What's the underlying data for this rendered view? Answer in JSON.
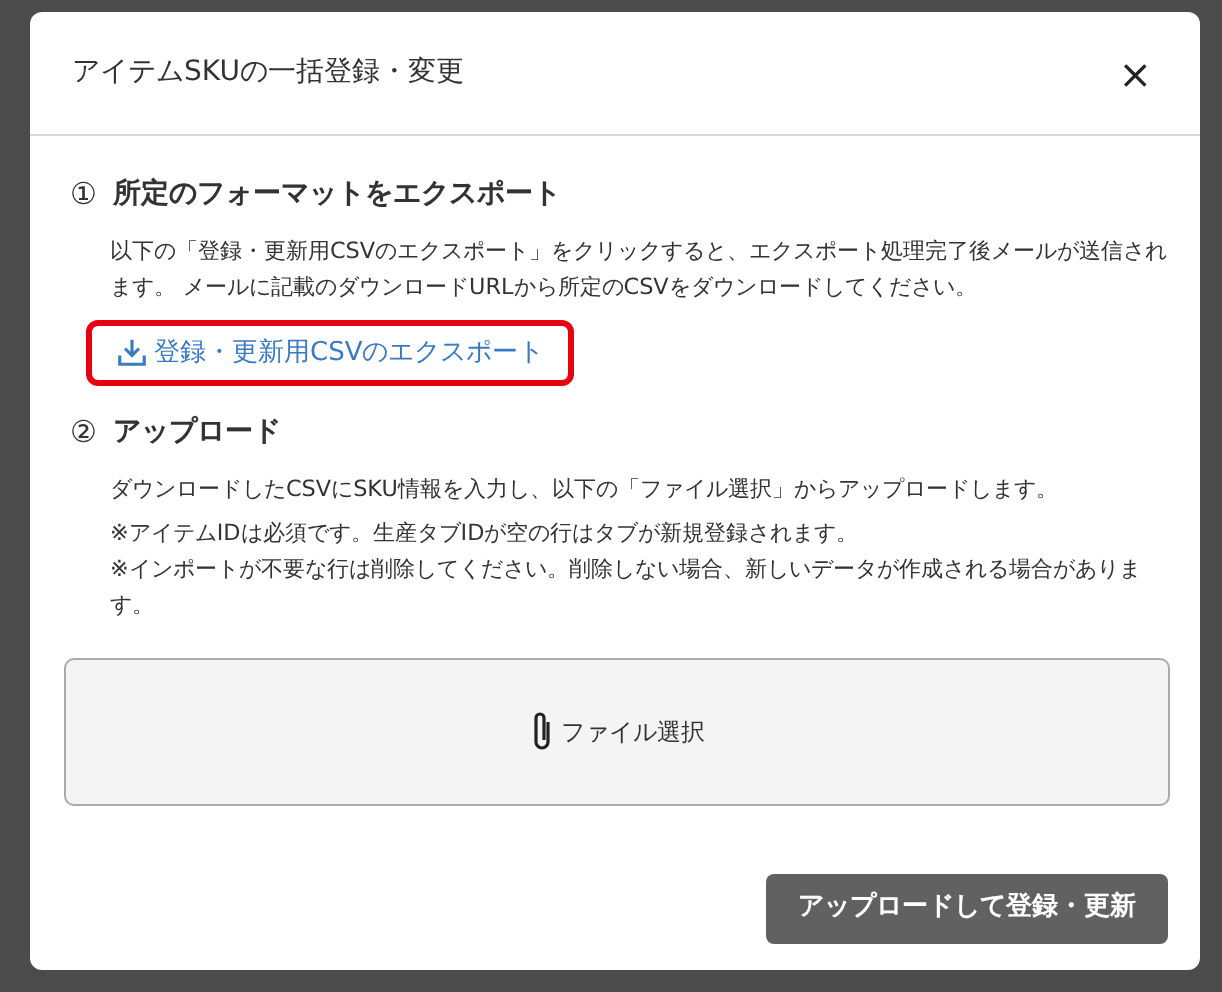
{
  "modal": {
    "title": "アイテムSKUの一括登録・変更",
    "close": "×",
    "sections": [
      {
        "number": "①",
        "heading": "所定のフォーマットをエクスポート",
        "paragraphs": [
          "以下の「登録・更新用CSVのエクスポート」をクリックすると、エクスポート処理完了後メールが送信されます。 メールに記載のダウンロードURLから所定のCSVをダウンロードしてください。"
        ],
        "link": {
          "label": "登録・更新用CSVのエクスポート",
          "highlighted": true
        }
      },
      {
        "number": "②",
        "heading": "アップロード",
        "paragraphs": [
          "ダウンロードしたCSVにSKU情報を入力し、以下の「ファイル選択」からアップロードします。",
          "※アイテムIDは必須です。生産タブIDが空の行はタブが新規登録されます。\n※インポートが不要な行は削除してください。削除しない場合、新しいデータが作成される場合があります。"
        ]
      }
    ],
    "dropzone": {
      "label": "ファイル選択"
    },
    "submit": {
      "label": "アップロードして登録・更新"
    }
  }
}
